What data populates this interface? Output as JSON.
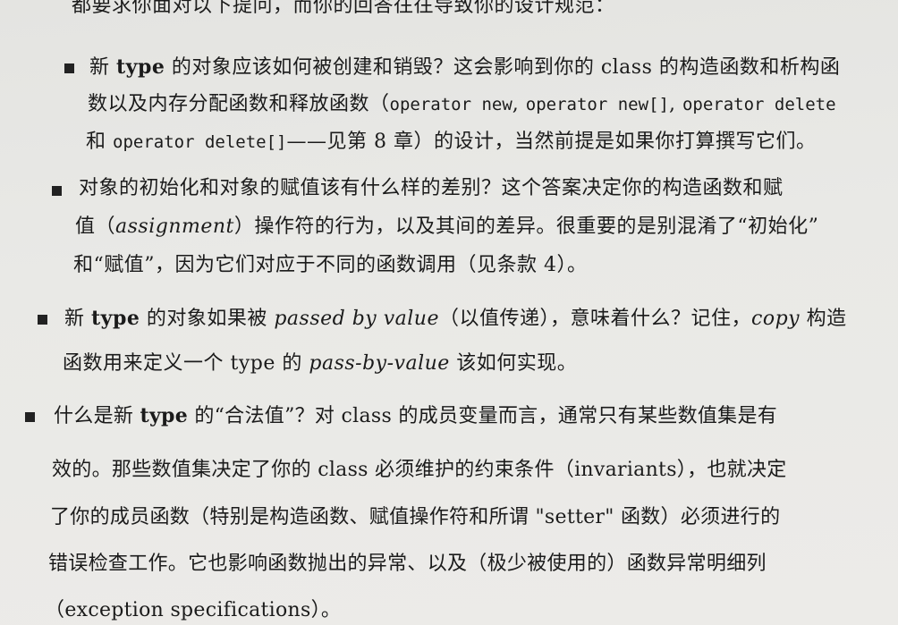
{
  "intro": {
    "line1": "都要求你面对以下提问，而你的回答往往导致你的设计规范："
  },
  "items": [
    {
      "lines": [
        [
          "新 ",
          "type",
          " 的对象应该如何被创建和销毁？这会影响到你的 ",
          "class",
          " 的构造函数和析构函"
        ],
        [
          "数以及内存分配函数和释放函数（",
          "operator new",
          ", ",
          "operator new[]",
          ", ",
          "operator delete",
          ""
        ],
        [
          "和 ",
          "operator delete[]",
          "——见第 8 章）的设计，当然前提是如果你打算撰写它们。"
        ]
      ]
    },
    {
      "lines": [
        [
          "对象的初始化和对象的赋值该有什么样的差别？这个答案决定你的构造函数和赋"
        ],
        [
          "值（",
          "assignment",
          "）操作符的行为，以及其间的差异。很重要的是别混淆了“初始化”"
        ],
        [
          "和“赋值”，因为它们对应于不同的函数调用（见条款 4）。"
        ]
      ]
    },
    {
      "lines": [
        [
          "新 ",
          "type",
          " 的对象如果被 ",
          "passed by value",
          "（以值传递），意味着什么？记住，",
          "copy",
          " 构造"
        ],
        [
          "函数用来定义一个 ",
          "type",
          " 的 ",
          "pass-by-value",
          " 该如何实现。"
        ]
      ]
    },
    {
      "lines": [
        [
          "什么是新 ",
          "type",
          " 的“合法值”？对 ",
          "class",
          " 的成员变量而言，通常只有某些数值集是有"
        ],
        [
          "效的。那些数值集决定了你的 ",
          "class",
          " 必须维护的约束条件（",
          "invariants",
          "），也就决定"
        ],
        [
          "了你的成员函数（特别是构造函数、赋值操作符和所谓 \"",
          "setter",
          "\" 函数）必须进行的"
        ],
        [
          "错误检查工作。它也影响函数抛出的异常、以及（极少被使用的）函数异常明细列"
        ],
        [
          "（",
          "exception specifications",
          "）。"
        ]
      ]
    }
  ]
}
